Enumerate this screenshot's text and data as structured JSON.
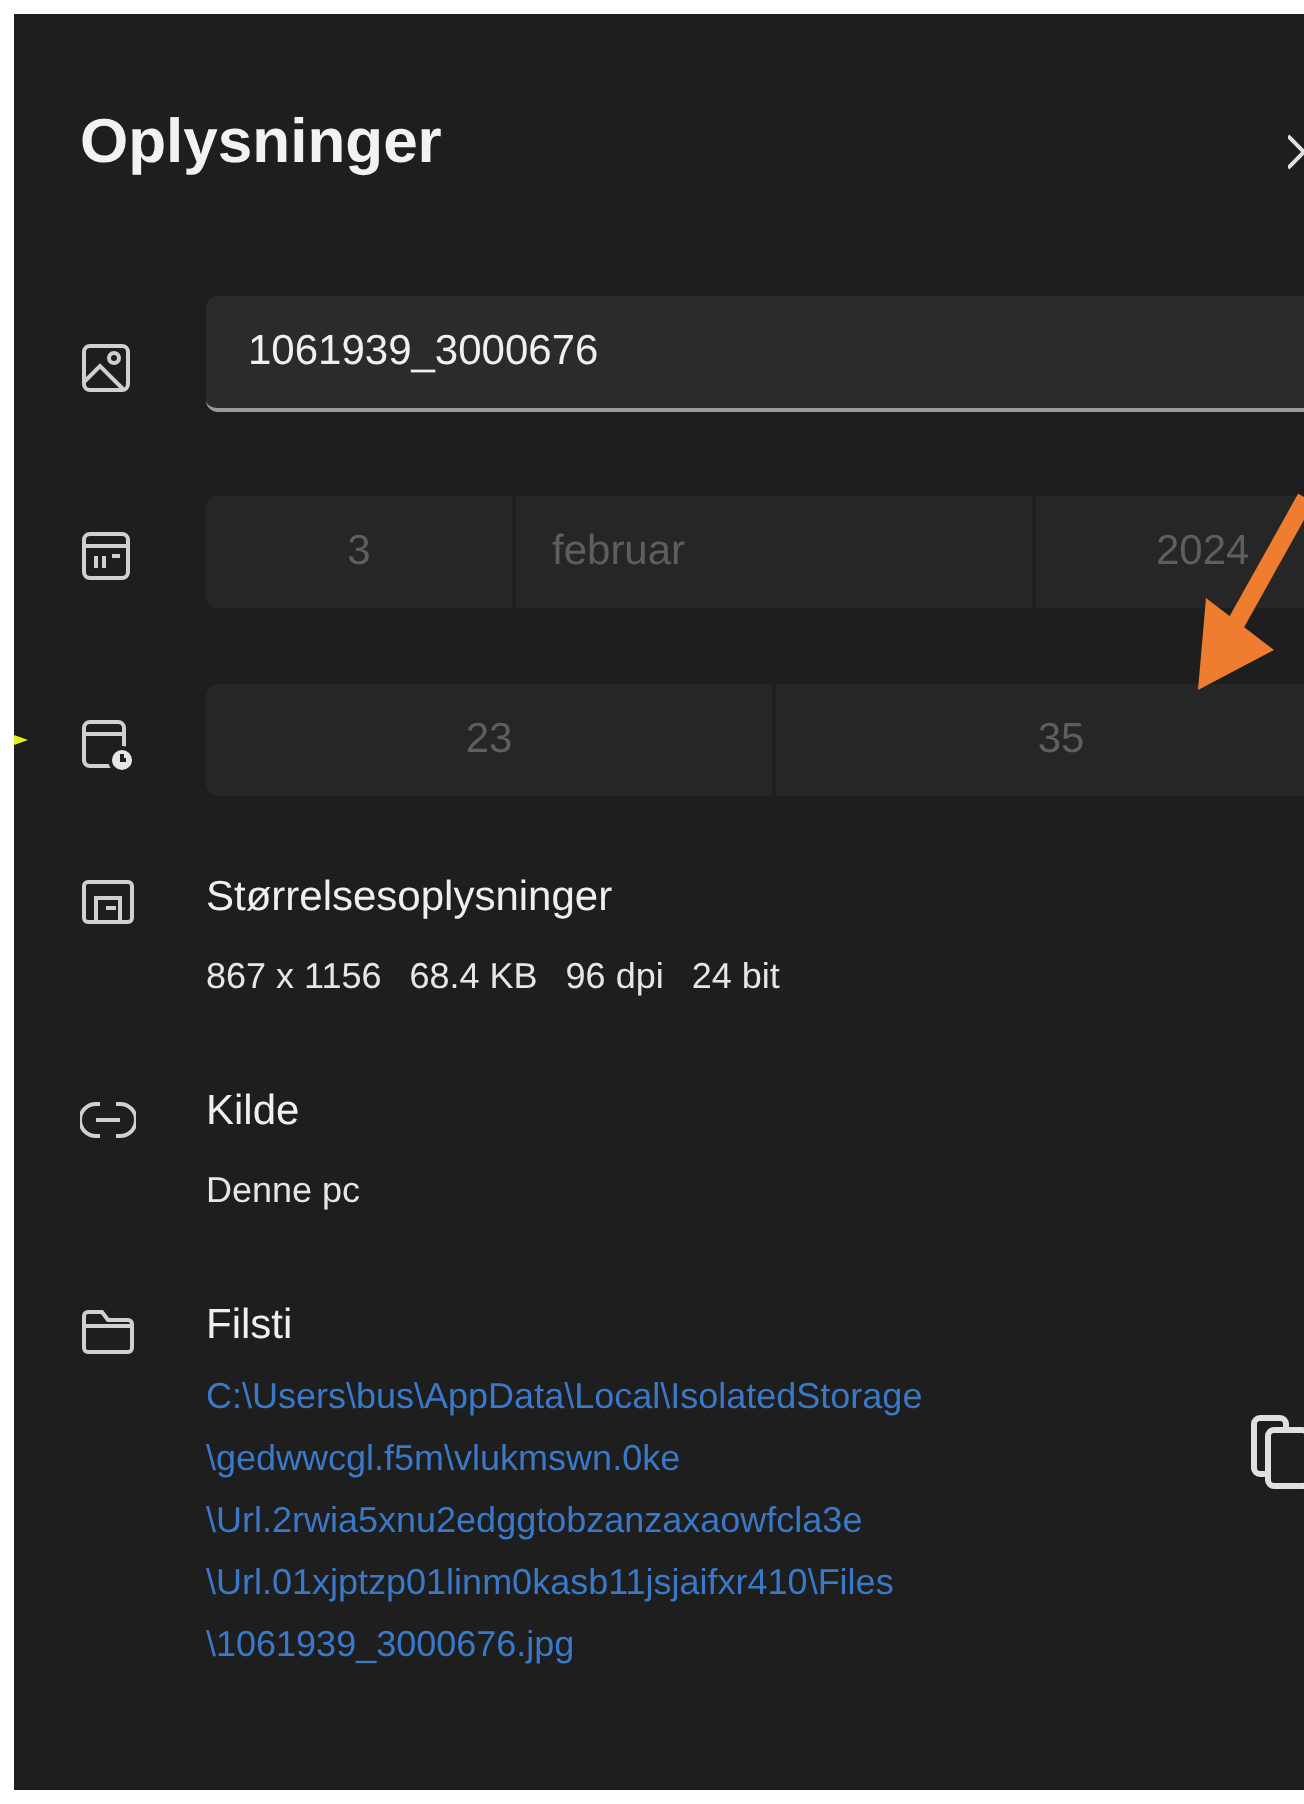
{
  "panel": {
    "title": "Oplysninger"
  },
  "name_field": {
    "value": "1061939_3000676"
  },
  "date": {
    "day": "3",
    "month": "februar",
    "year": "2024",
    "disabled": true
  },
  "time": {
    "hour": "23",
    "minute": "35",
    "disabled": true
  },
  "sections": [
    {
      "kind": "size",
      "heading": "Størrelsesoplysninger",
      "values": [
        "867 x 1156",
        "68.4 KB",
        "96 dpi",
        "24 bit"
      ]
    },
    {
      "kind": "source",
      "heading": "Kilde",
      "values": [
        "Denne pc"
      ]
    },
    {
      "kind": "path",
      "heading": "Filsti",
      "path_lines": [
        "C:\\Users\\bus\\AppData\\Local\\IsolatedStorage",
        "\\gedwwcgl.f5m\\vlukmswn.0ke",
        "\\Url.2rwia5xnu2edggtobzanzaxaowfcla3e",
        "\\Url.01xjptzp01linm0kasb11jsjaifxr410\\Files",
        "\\1061939_3000676.jpg"
      ]
    }
  ]
}
